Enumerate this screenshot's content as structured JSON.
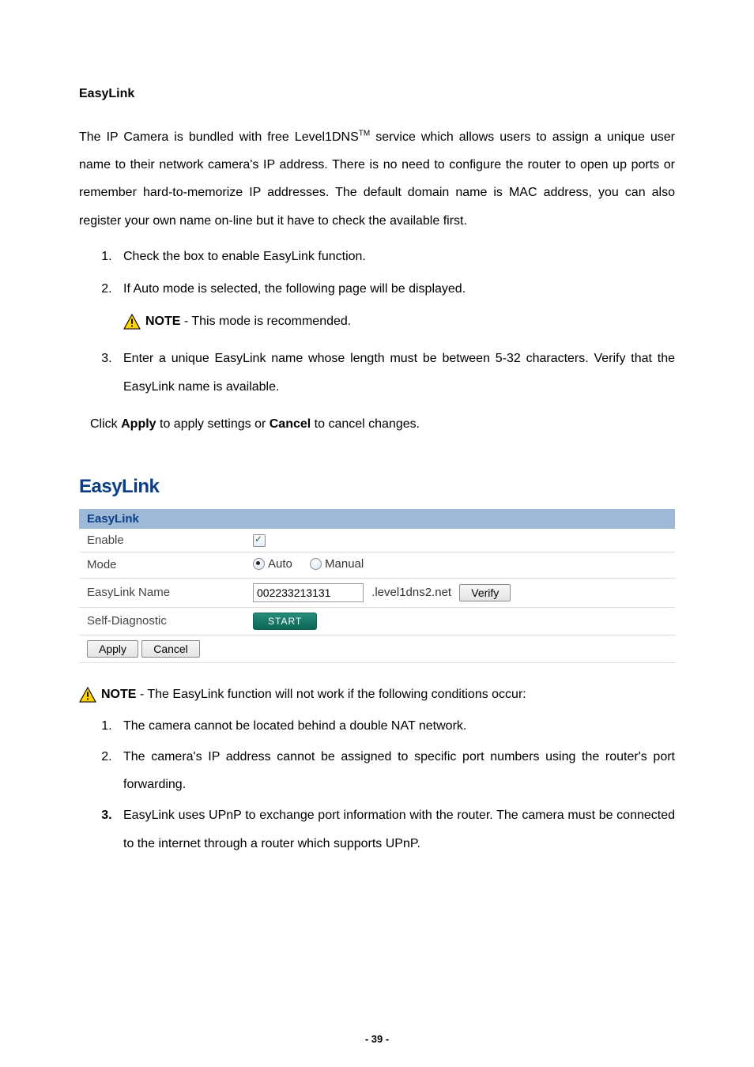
{
  "heading": "EasyLink",
  "intro": {
    "part1": "The IP Camera is bundled with free Level1DNS",
    "tm": "TM",
    "part2": " service which allows users to assign a unique user name to their network camera's IP address. There is no need to configure the router to open up ports or remember hard-to-memorize IP addresses. The default domain name is MAC address, you can also register your own name on-line but it have to check the available first."
  },
  "list1": [
    "Check the box to enable EasyLink function.",
    "If Auto mode is selected, the following page will be displayed.",
    "Enter a unique EasyLink name whose length must be between 5-32 characters.   Verify that the EasyLink name is available."
  ],
  "note1": {
    "label": "NOTE",
    "text": " - This mode is recommended."
  },
  "after_list": {
    "pre": "Click ",
    "s1": "Apply",
    "mid": " to apply settings or ",
    "s2": "Cancel",
    "post": " to cancel changes."
  },
  "panel": {
    "title": "EasyLink",
    "section": "EasyLink",
    "rows": {
      "enable": "Enable",
      "mode": "Mode",
      "mode_auto": "Auto",
      "mode_manual": "Manual",
      "name": "EasyLink Name",
      "name_value": "002233213131",
      "name_suffix": ".level1dns2.net",
      "verify": "Verify",
      "selfdiag": "Self-Diagnostic",
      "start": "START",
      "apply": "Apply",
      "cancel": "Cancel"
    }
  },
  "note2": {
    "label": "NOTE",
    "text": " - The EasyLink function will not work if the following conditions occur:"
  },
  "list2": [
    "The camera cannot be located behind a double NAT network.",
    "The camera's IP address cannot be assigned to specific port numbers using the router's port forwarding.",
    "EasyLink uses UPnP to exchange port information with the router. The camera must be connected to the internet through a router which supports UPnP."
  ],
  "page_number": "- 39 -"
}
